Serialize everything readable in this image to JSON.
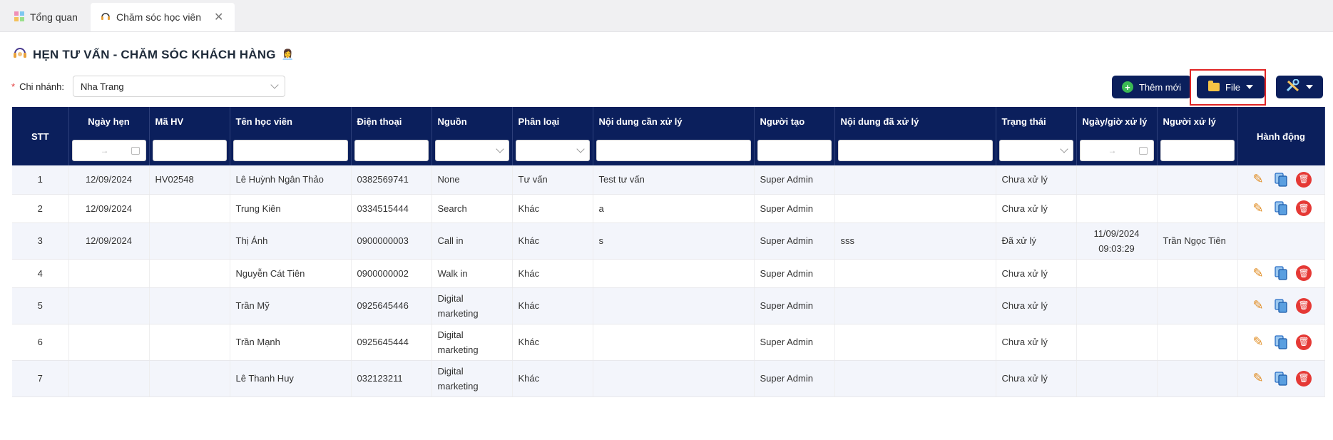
{
  "tabs": [
    {
      "label": "Tổng quan",
      "icon": "grid-icon",
      "active": false
    },
    {
      "label": "Chăm sóc học viên",
      "icon": "headset-icon",
      "active": true
    }
  ],
  "page": {
    "title": "HẸN TƯ VẤN - CHĂM SÓC KHÁCH HÀNG",
    "emoji": "👩‍💼"
  },
  "branch": {
    "label": "Chi nhánh:",
    "value": "Nha Trang"
  },
  "toolbar": {
    "add_label": "Thêm mới",
    "file_label": "File"
  },
  "table": {
    "headers": {
      "stt": "STT",
      "date": "Ngày hẹn",
      "code": "Mã HV",
      "name": "Tên học viên",
      "phone": "Điện thoại",
      "source": "Nguồn",
      "type": "Phân loại",
      "todo": "Nội dung cần xử lý",
      "creator": "Người tạo",
      "done": "Nội dung đã xử lý",
      "status": "Trạng thái",
      "handled_at": "Ngày/giờ xử lý",
      "handler": "Người xử lý",
      "actions": "Hành động"
    },
    "rows": [
      {
        "stt": "1",
        "date": "12/09/2024",
        "code": "HV02548",
        "name": "Lê Huỳnh Ngân Thảo",
        "phone": "0382569741",
        "source": "None",
        "type": "Tư vấn",
        "todo": "Test tư vấn",
        "creator": "Super Admin",
        "done": "",
        "status": "Chưa xử lý",
        "handled_at": "",
        "handler": "",
        "has_actions": true
      },
      {
        "stt": "2",
        "date": "12/09/2024",
        "code": "",
        "name": "Trung Kiên",
        "phone": "0334515444",
        "source": "Search",
        "type": "Khác",
        "todo": "a",
        "creator": "Super Admin",
        "done": "",
        "status": "Chưa xử lý",
        "handled_at": "",
        "handler": "",
        "has_actions": true
      },
      {
        "stt": "3",
        "date": "12/09/2024",
        "code": "",
        "name": "Thị Ánh",
        "phone": "0900000003",
        "source": "Call in",
        "type": "Khác",
        "todo": "s",
        "creator": "Super Admin",
        "done": "sss",
        "status": "Đã xử lý",
        "handled_at": "11/09/2024 09:03:29",
        "handler": "Trần Ngọc Tiên",
        "has_actions": false
      },
      {
        "stt": "4",
        "date": "",
        "code": "",
        "name": "Nguyễn Cát Tiên",
        "phone": "0900000002",
        "source": "Walk in",
        "type": "Khác",
        "todo": "",
        "creator": "Super Admin",
        "done": "",
        "status": "Chưa xử lý",
        "handled_at": "",
        "handler": "",
        "has_actions": true
      },
      {
        "stt": "5",
        "date": "",
        "code": "",
        "name": "Trần Mỹ",
        "phone": "0925645446",
        "source": "Digital marketing",
        "type": "Khác",
        "todo": "",
        "creator": "Super Admin",
        "done": "",
        "status": "Chưa xử lý",
        "handled_at": "",
        "handler": "",
        "has_actions": true
      },
      {
        "stt": "6",
        "date": "",
        "code": "",
        "name": "Trần Mạnh",
        "phone": "0925645444",
        "source": "Digital marketing",
        "type": "Khác",
        "todo": "",
        "creator": "Super Admin",
        "done": "",
        "status": "Chưa xử lý",
        "handled_at": "",
        "handler": "",
        "has_actions": true
      },
      {
        "stt": "7",
        "date": "",
        "code": "",
        "name": "Lê Thanh Huy",
        "phone": "032123211",
        "source": "Digital marketing",
        "type": "Khác",
        "todo": "",
        "creator": "Super Admin",
        "done": "",
        "status": "Chưa xử lý",
        "handled_at": "",
        "handler": "",
        "has_actions": true
      }
    ]
  },
  "colors": {
    "header_bg": "#0b1f5c",
    "accent_add": "#3cba54",
    "delete": "#e53935",
    "highlight": "#e02424"
  }
}
